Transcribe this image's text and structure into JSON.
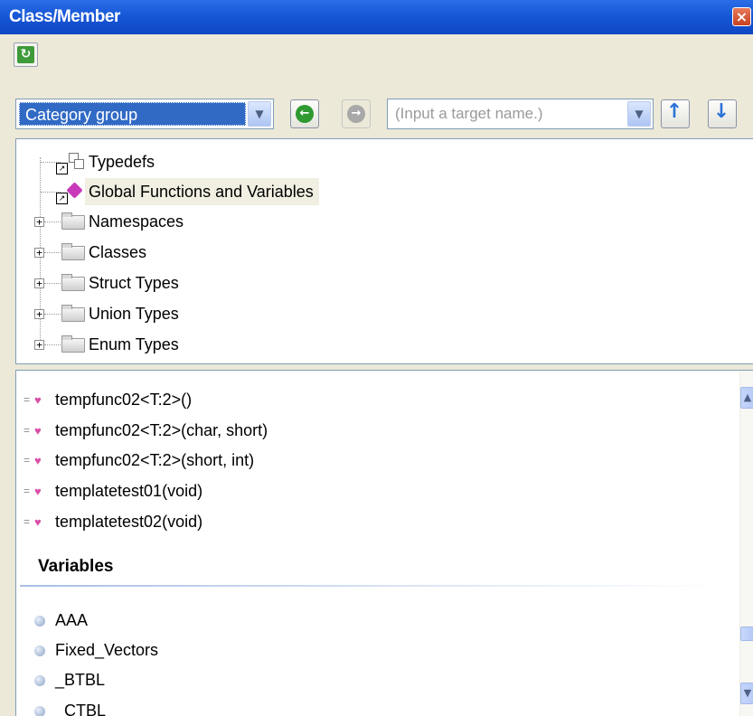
{
  "window": {
    "title": "Class/Member",
    "close_glyph": "×"
  },
  "toolbar": {
    "refresh_icon": "refresh-icon",
    "refresh_glyph": "↻"
  },
  "nav": {
    "category_value": "Category group",
    "target_placeholder": "(Input a target name.)",
    "dropdown_glyph": "▼",
    "back_glyph": "←",
    "forward_glyph": "→",
    "up_glyph": "↑",
    "down_glyph": "↓"
  },
  "tree": {
    "items": [
      {
        "label": "Typedefs",
        "icon": "typedef-icon",
        "expandable": false
      },
      {
        "label": "Global Functions and Variables",
        "icon": "global-functions-icon",
        "expandable": false,
        "selected": true
      },
      {
        "label": "Namespaces",
        "icon": "folder-icon",
        "expandable": true
      },
      {
        "label": "Classes",
        "icon": "folder-icon",
        "expandable": true
      },
      {
        "label": "Struct Types",
        "icon": "folder-icon",
        "expandable": true
      },
      {
        "label": "Union Types",
        "icon": "folder-icon",
        "expandable": true
      },
      {
        "label": "Enum Types",
        "icon": "folder-icon",
        "expandable": true
      }
    ],
    "expander_glyph": "+",
    "link_glyph": "↗"
  },
  "members": {
    "functions": [
      "tempfunc02<T:2>()",
      "tempfunc02<T:2>(char, short)",
      "tempfunc02<T:2>(short, int)",
      "templatetest01(void)",
      "templatetest02(void)"
    ],
    "variables_header": "Variables",
    "variables": [
      "AAA",
      "Fixed_Vectors",
      "_BTBL",
      "_CTBL"
    ]
  },
  "scrollbar": {
    "up_glyph": "▲",
    "down_glyph": "▼"
  }
}
